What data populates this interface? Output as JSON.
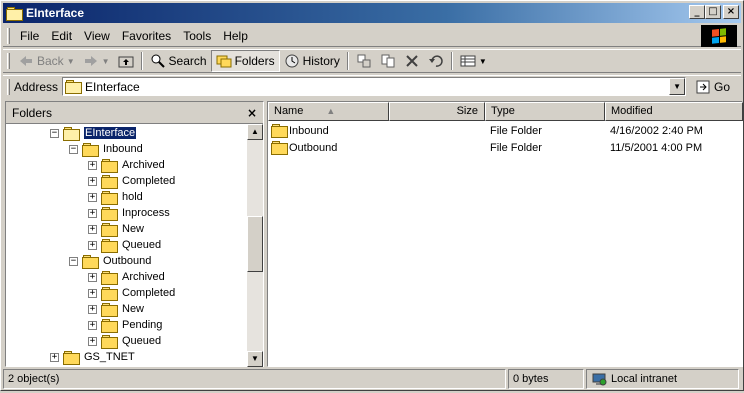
{
  "window": {
    "title": "EInterface"
  },
  "menu": [
    "File",
    "Edit",
    "View",
    "Favorites",
    "Tools",
    "Help"
  ],
  "toolbar": {
    "back_label": "Back",
    "search_label": "Search",
    "folders_label": "Folders",
    "history_label": "History"
  },
  "address": {
    "label": "Address",
    "value": "EInterface",
    "go_label": "Go"
  },
  "folders_pane": {
    "title": "Folders",
    "tree": [
      {
        "label": "EInterface",
        "level": 0,
        "expander": "−",
        "selected": true
      },
      {
        "label": "Inbound",
        "level": 1,
        "expander": "−"
      },
      {
        "label": "Archived",
        "level": 2,
        "expander": "+"
      },
      {
        "label": "Completed",
        "level": 2,
        "expander": "+"
      },
      {
        "label": "hold",
        "level": 2,
        "expander": "+"
      },
      {
        "label": "Inprocess",
        "level": 2,
        "expander": "+"
      },
      {
        "label": "New",
        "level": 2,
        "expander": "+"
      },
      {
        "label": "Queued",
        "level": 2,
        "expander": "+"
      },
      {
        "label": "Outbound",
        "level": 1,
        "expander": "−"
      },
      {
        "label": "Archived",
        "level": 2,
        "expander": "+"
      },
      {
        "label": "Completed",
        "level": 2,
        "expander": "+"
      },
      {
        "label": "New",
        "level": 2,
        "expander": "+"
      },
      {
        "label": "Pending",
        "level": 2,
        "expander": "+"
      },
      {
        "label": "Queued",
        "level": 2,
        "expander": "+"
      },
      {
        "label": "GS_TNET",
        "level": 0,
        "expander": "+"
      }
    ]
  },
  "list": {
    "columns": [
      "Name",
      "Size",
      "Type",
      "Modified"
    ],
    "rows": [
      {
        "name": "Inbound",
        "size": "",
        "type": "File Folder",
        "modified": "4/16/2002 2:40 PM"
      },
      {
        "name": "Outbound",
        "size": "",
        "type": "File Folder",
        "modified": "11/5/2001 4:00 PM"
      }
    ]
  },
  "status": {
    "objects": "2 object(s)",
    "size": "0 bytes",
    "zone": "Local intranet"
  }
}
